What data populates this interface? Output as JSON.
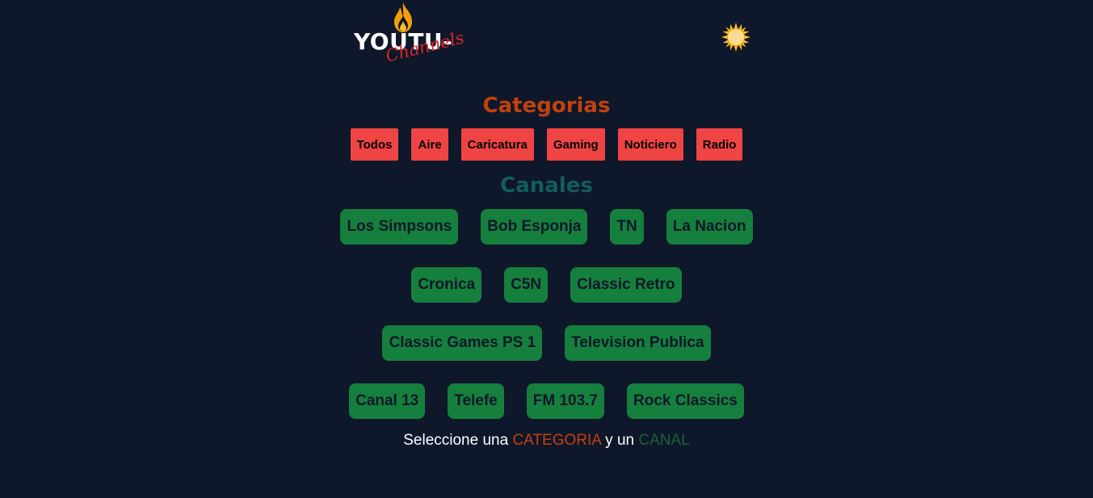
{
  "header": {
    "logo_main": "YOUTU-",
    "logo_sub": "Channels",
    "logo_icon": "flame-icon",
    "theme_icon": "sun-icon"
  },
  "categories": {
    "title": "Categorias",
    "items": [
      "Todos",
      "Aire",
      "Caricatura",
      "Gaming",
      "Noticiero",
      "Radio"
    ]
  },
  "channels": {
    "title": "Canales",
    "rows": [
      [
        "Los Simpsons",
        "Bob Esponja",
        "TN",
        "La Nacion"
      ],
      [
        "Cronica",
        "C5N",
        "Classic Retro"
      ],
      [
        "Classic Games PS 1",
        "Television Publica"
      ],
      [
        "Canal 13",
        "Telefe",
        "FM 103.7",
        "Rock Classics"
      ]
    ]
  },
  "hint": {
    "prefix": "Seleccione una ",
    "category_word": "CATEGORIA",
    "middle": " y un ",
    "channel_word": "CANAL"
  },
  "colors": {
    "background": "#0f172a",
    "category_button": "#ef4444",
    "channel_button": "#15803d",
    "categories_title": "#c2410c",
    "channels_title": "#115e59"
  }
}
